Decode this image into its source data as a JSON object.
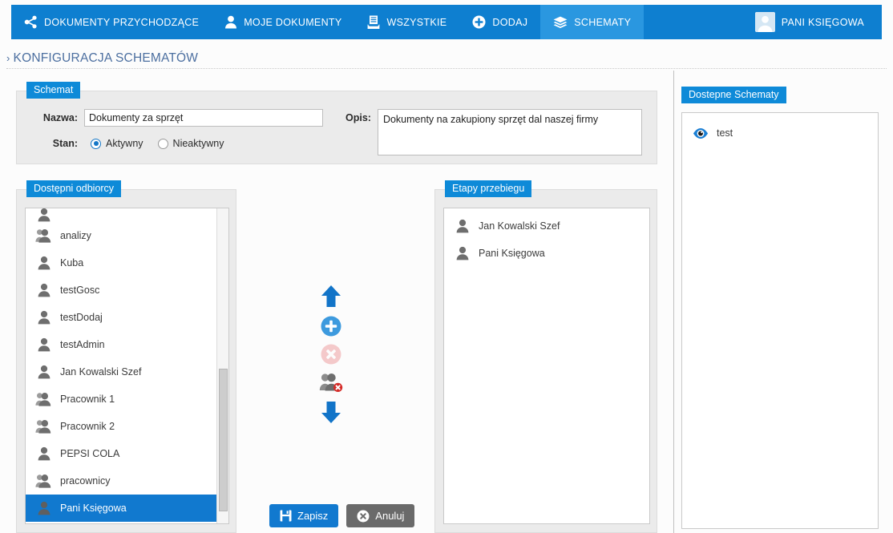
{
  "nav": {
    "items": [
      {
        "icon": "share-nodes-icon",
        "label": "DOKUMENTY PRZYCHODZĄCE",
        "active": false
      },
      {
        "icon": "user-icon",
        "label": "MOJE DOKUMENTY",
        "active": false
      },
      {
        "icon": "inbox-icon",
        "label": "WSZYSTKIE",
        "active": false
      },
      {
        "icon": "plus-circle-icon",
        "label": "DODAJ",
        "active": false
      },
      {
        "icon": "layers-icon",
        "label": "SCHEMATY",
        "active": true
      }
    ],
    "user": {
      "icon": "avatar-icon",
      "label": "PANI KSIĘGOWA"
    }
  },
  "breadcrumb": {
    "chevron": "›",
    "title": "KONFIGURACJA SCHEMATÓW"
  },
  "schemat": {
    "legend": "Schemat",
    "name_label": "Nazwa:",
    "name_value": "Dokumenty za sprzęt",
    "desc_label": "Opis:",
    "desc_value": "Dokumenty na zakupiony sprzęt dal naszej firmy",
    "state_label": "Stan:",
    "state_options": [
      {
        "label": "Aktywny",
        "selected": true
      },
      {
        "label": "Nieaktywny",
        "selected": false
      }
    ]
  },
  "recipients": {
    "legend": "Dostępni odbiorcy",
    "items": [
      {
        "label": "",
        "icon": "user-icon",
        "selected": false,
        "clipped": true
      },
      {
        "label": "analizy",
        "icon": "group-icon",
        "selected": false
      },
      {
        "label": "Kuba",
        "icon": "user-icon",
        "selected": false
      },
      {
        "label": "testGosc",
        "icon": "user-icon",
        "selected": false
      },
      {
        "label": "testDodaj",
        "icon": "user-icon",
        "selected": false
      },
      {
        "label": "testAdmin",
        "icon": "user-icon",
        "selected": false
      },
      {
        "label": "Jan Kowalski Szef",
        "icon": "user-icon",
        "selected": false
      },
      {
        "label": "Pracownik 1",
        "icon": "group-icon",
        "selected": false
      },
      {
        "label": "Pracownik 2",
        "icon": "group-icon",
        "selected": false
      },
      {
        "label": "PEPSI COLA",
        "icon": "user-icon",
        "selected": false
      },
      {
        "label": "pracownicy",
        "icon": "group-icon",
        "selected": false
      },
      {
        "label": "Pani Księgowa",
        "icon": "user-icon",
        "selected": true
      }
    ]
  },
  "mid_actions": [
    {
      "name": "move-up-button",
      "icon": "arrow-up-icon",
      "enabled": true
    },
    {
      "name": "add-button",
      "icon": "plus-circle-icon",
      "enabled": true
    },
    {
      "name": "remove-button",
      "icon": "x-circle-icon",
      "enabled": false
    },
    {
      "name": "remove-user-button",
      "icon": "user-remove-icon",
      "enabled": true
    },
    {
      "name": "move-down-button",
      "icon": "arrow-down-icon",
      "enabled": true
    }
  ],
  "stages": {
    "legend": "Etapy przebiegu",
    "items": [
      {
        "label": "Jan Kowalski Szef",
        "icon": "user-icon"
      },
      {
        "label": "Pani Księgowa",
        "icon": "user-icon"
      }
    ]
  },
  "schemes": {
    "legend": "Dostepne Schematy",
    "items": [
      {
        "label": "test",
        "icon": "eye-icon"
      }
    ]
  },
  "buttons": {
    "save": {
      "label": "Zapisz",
      "icon": "floppy-icon"
    },
    "cancel": {
      "label": "Anuluj",
      "icon": "x-circle-icon"
    }
  },
  "colors": {
    "brand_blue": "#0e7fd0",
    "active_tab": "#2a97e0",
    "legend_blue": "#0e8ad8",
    "selection_blue": "#1179cf",
    "breadcrumb_text": "#4c6fa0",
    "panel_bg": "#ebebeb",
    "page_bg": "#fcfcfc"
  }
}
